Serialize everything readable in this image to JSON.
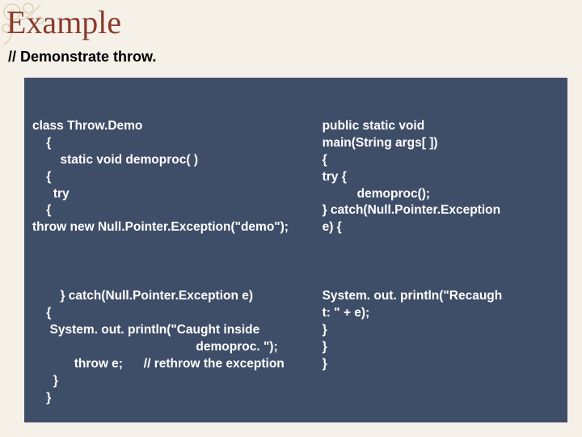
{
  "title": "Example",
  "subtitle": "// Demonstrate throw.",
  "left_block1": "class Throw.Demo\n    {\n        static void demoproc( )\n    {\n      try\n    {\nthrow new Null.Pointer.Exception(\"demo\");",
  "left_block2": "        } catch(Null.Pointer.Exception e)\n    {\n     System. out. println(\"Caught inside\n                                               demoproc. \");\n            throw e;      // rethrow the exception\n      }\n    }",
  "right_block1": "public static void\nmain(String args[ ])\n{\ntry {\n          demoproc();\n} catch(Null.Pointer.Exception\ne) {",
  "right_block2": "System. out. println(\"Recaugh\nt: \" + e);\n}\n}\n}"
}
